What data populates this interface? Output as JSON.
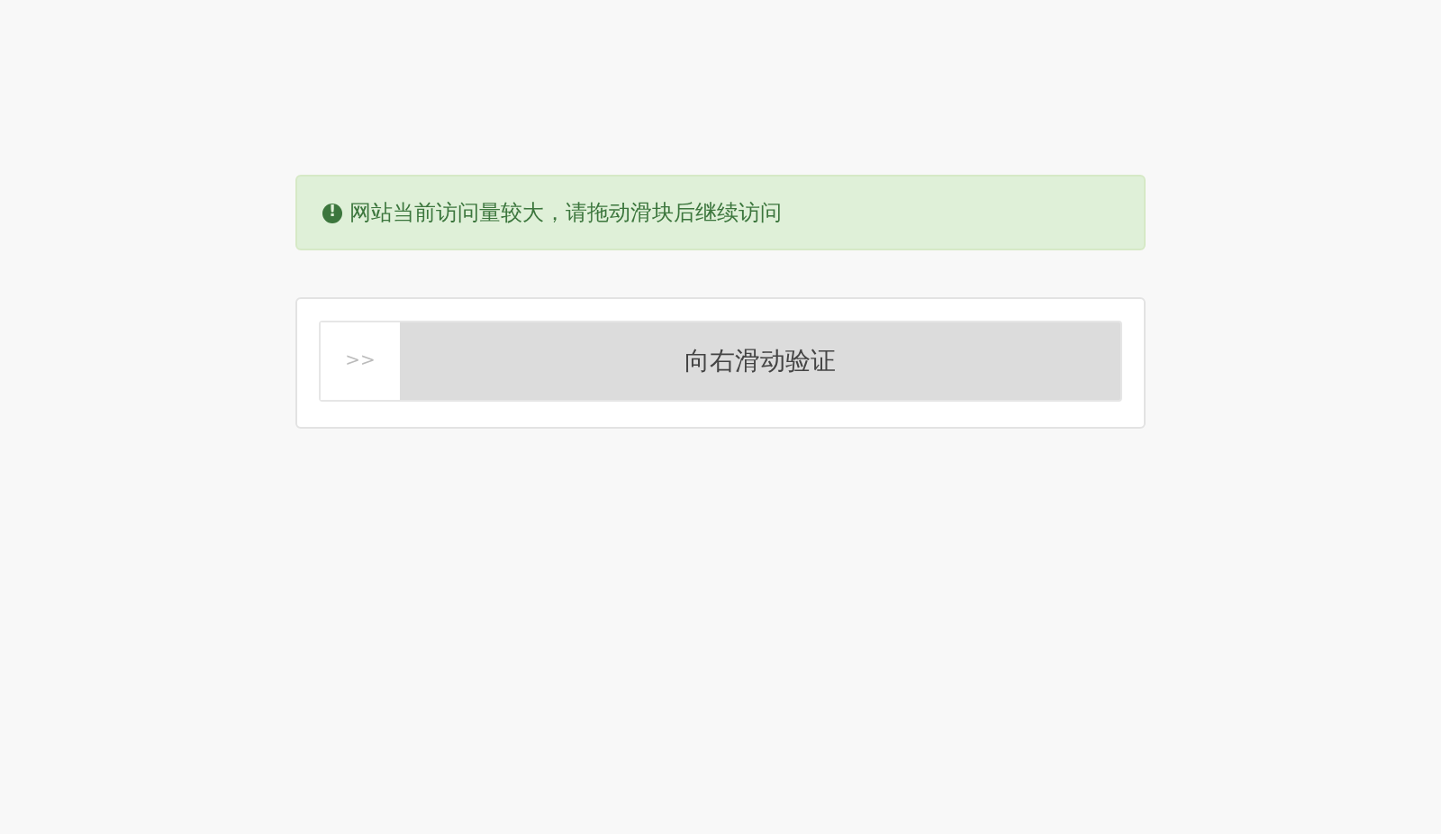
{
  "alert": {
    "icon": "!",
    "message": "网站当前访问量较大，请拖动滑块后继续访问"
  },
  "slider": {
    "handle": ">>",
    "label": "向右滑动验证",
    "level": 0
  }
}
